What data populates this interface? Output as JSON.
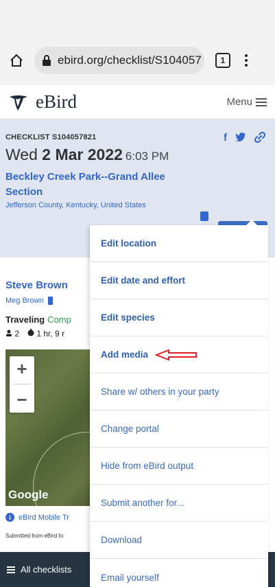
{
  "browser": {
    "url": "ebird.org/checklist/S104057",
    "tab_count": "1"
  },
  "site": {
    "logo_text": "eBird",
    "menu_label": "Menu"
  },
  "checklist": {
    "id_label": "CHECKLIST S104057821",
    "date_prefix": "Wed ",
    "date_bold": "2 Mar 2022",
    "time": "6:03 PM",
    "location_name": "Beckley Creek Park--Grand Allee Section",
    "location_region": "Jefferson County, Kentucky, United States",
    "share": {
      "facebook": "f",
      "twitter": "🐦",
      "link": "🔗"
    }
  },
  "observers": {
    "primary": "Steve Brown",
    "secondary": "Meg Brown"
  },
  "effort": {
    "protocol": "Traveling",
    "complete": "Comp",
    "party_size": "2",
    "duration": "1 hr, 9 r"
  },
  "map": {
    "zoom_in": "+",
    "zoom_out": "−",
    "attribution": "Google"
  },
  "app_note": "eBird Mobile Tr",
  "submitted_note": "Submitted from eBird fo",
  "footer": {
    "all_checklists": "All checklists"
  },
  "dropdown": {
    "items": [
      {
        "label": "Edit location"
      },
      {
        "label": "Edit date and effort"
      },
      {
        "label": "Edit species"
      },
      {
        "label": "Add media"
      },
      {
        "label": "Share w/ others in your party"
      },
      {
        "label": "Change portal"
      },
      {
        "label": "Hide from eBird output"
      },
      {
        "label": "Submit another for..."
      },
      {
        "label": "Download"
      },
      {
        "label": "Email yourself"
      }
    ]
  },
  "colors": {
    "accent": "#3366cc",
    "edit_button": "#3b6cc2",
    "header_bg": "#dfe6f1",
    "footer_bg": "#263541",
    "annotation_arrow": "#e02020"
  }
}
